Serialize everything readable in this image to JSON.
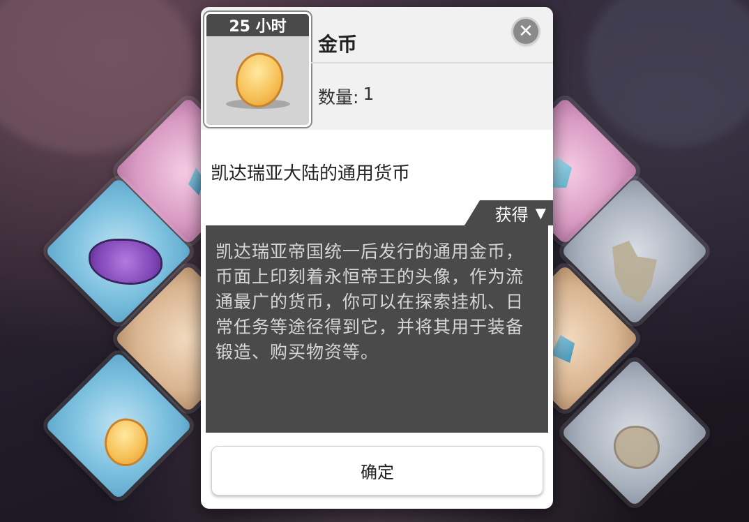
{
  "item": {
    "timer": "25 小时",
    "name": "金币",
    "quantity_label": "数量:",
    "quantity_value": "1",
    "icon": "gold-coin-icon"
  },
  "description": {
    "short": "凯达瑞亚大陆的通用货币",
    "lore": "凯达瑞亚帝国统一后发行的通用金币，币面上印刻着永恒帝王的头像，作为流通最广的货币，你可以在探索挂机、日常任务等途径得到它，并将其用于装备锻造、购买物资等。"
  },
  "obtain": {
    "label": "获得",
    "arrow": "▼"
  },
  "buttons": {
    "close_symbol": "✕",
    "confirm": "确定"
  },
  "colors": {
    "panel_dark": "#4a4a4a",
    "header_bg": "#f1f1f1",
    "coin_gold": "#f7c25a"
  }
}
